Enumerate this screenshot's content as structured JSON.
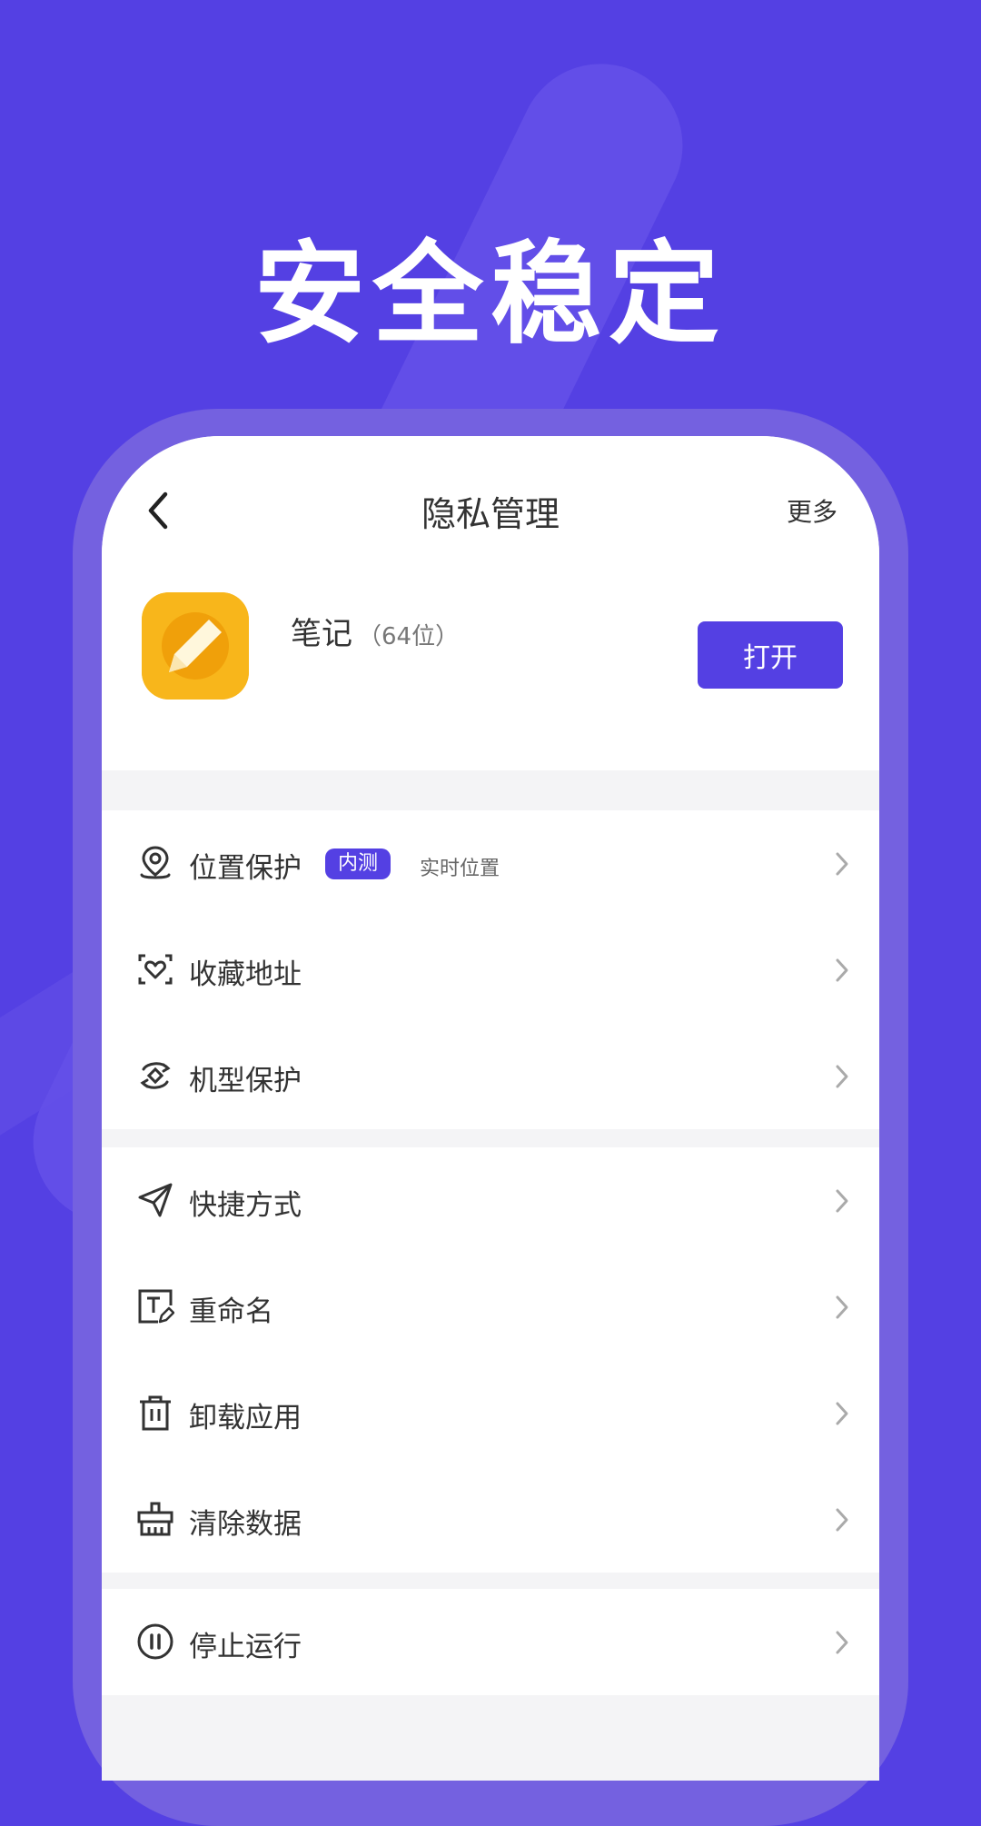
{
  "hero": {
    "title": "安全稳定"
  },
  "nav": {
    "title": "隐私管理",
    "more_label": "更多"
  },
  "app": {
    "name": "笔记",
    "meta": "（64位）",
    "open_label": "打开"
  },
  "groups": [
    {
      "items": [
        {
          "label": "位置保护",
          "icon": "location-pin-icon",
          "badge": "内测",
          "sub_label": "实时位置"
        },
        {
          "label": "收藏地址",
          "icon": "heart-frame-icon"
        },
        {
          "label": "机型保护",
          "icon": "device-sync-icon"
        }
      ]
    },
    {
      "items": [
        {
          "label": "快捷方式",
          "icon": "send-icon"
        },
        {
          "label": "重命名",
          "icon": "rename-icon"
        },
        {
          "label": "卸载应用",
          "icon": "trash-icon"
        },
        {
          "label": "清除数据",
          "icon": "broom-icon"
        }
      ]
    },
    {
      "items": [
        {
          "label": "停止运行",
          "icon": "pause-circle-icon"
        }
      ]
    }
  ],
  "colors": {
    "background": "#5440e3",
    "accent": "#5440e3",
    "app_icon": "#f8b61b"
  }
}
